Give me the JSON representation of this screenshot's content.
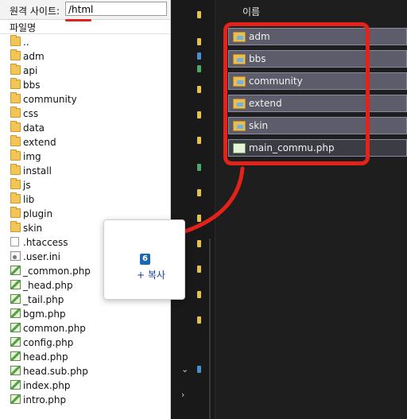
{
  "left_panel": {
    "address_label": "원격 사이트:",
    "address_value": "/html",
    "column_header": "파일명",
    "items": [
      {
        "name": "..",
        "type": "folder"
      },
      {
        "name": "adm",
        "type": "folder"
      },
      {
        "name": "api",
        "type": "folder"
      },
      {
        "name": "bbs",
        "type": "folder"
      },
      {
        "name": "community",
        "type": "folder"
      },
      {
        "name": "css",
        "type": "folder"
      },
      {
        "name": "data",
        "type": "folder"
      },
      {
        "name": "extend",
        "type": "folder"
      },
      {
        "name": "img",
        "type": "folder"
      },
      {
        "name": "install",
        "type": "folder"
      },
      {
        "name": "js",
        "type": "folder"
      },
      {
        "name": "lib",
        "type": "folder"
      },
      {
        "name": "plugin",
        "type": "folder"
      },
      {
        "name": "skin",
        "type": "folder"
      },
      {
        "name": ".htaccess",
        "type": "file"
      },
      {
        "name": ".user.ini",
        "type": "ini"
      },
      {
        "name": "_common.php",
        "type": "php"
      },
      {
        "name": "_head.php",
        "type": "php"
      },
      {
        "name": "_tail.php",
        "type": "php"
      },
      {
        "name": "bgm.php",
        "type": "php"
      },
      {
        "name": "common.php",
        "type": "php"
      },
      {
        "name": "config.php",
        "type": "php"
      },
      {
        "name": "head.php",
        "type": "php"
      },
      {
        "name": "head.sub.php",
        "type": "php"
      },
      {
        "name": "index.php",
        "type": "php"
      },
      {
        "name": "intro.php",
        "type": "php"
      }
    ]
  },
  "right_panel": {
    "column_header": "이름",
    "items": [
      {
        "name": "adm",
        "type": "folder"
      },
      {
        "name": "bbs",
        "type": "folder"
      },
      {
        "name": "community",
        "type": "folder"
      },
      {
        "name": "extend",
        "type": "folder"
      },
      {
        "name": "skin",
        "type": "folder"
      },
      {
        "name": "main_commu.php",
        "type": "php"
      }
    ]
  },
  "drag_tooltip": {
    "count": "6",
    "action": "+ 복사"
  },
  "colors": {
    "highlight_red": "#e3221a",
    "selection": "#5c5c6a",
    "badge_blue": "#1a67b3"
  }
}
